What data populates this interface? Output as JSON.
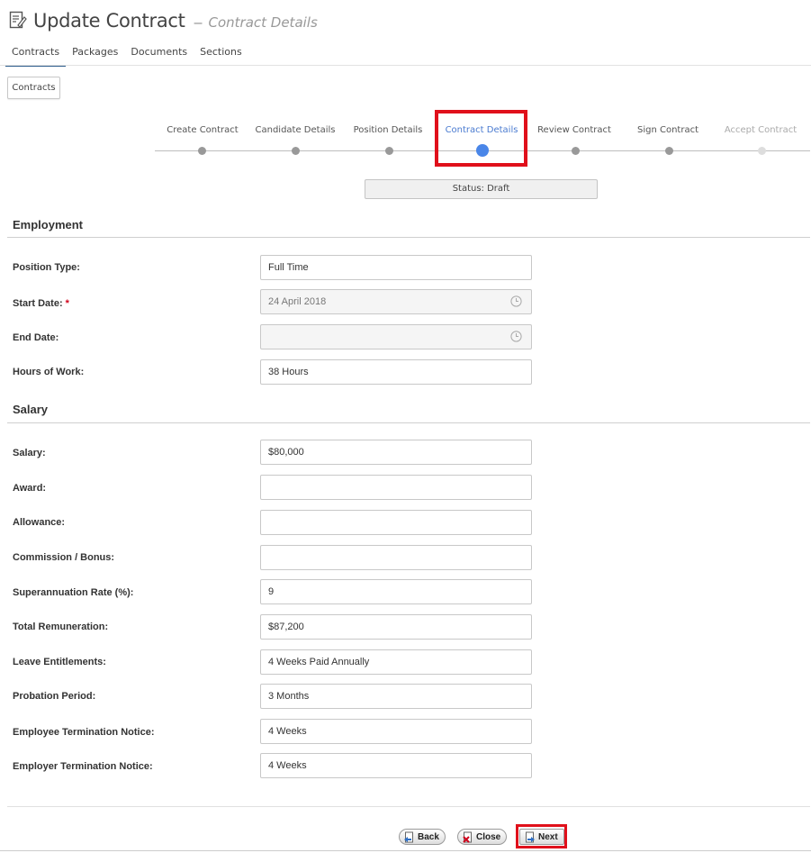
{
  "header": {
    "title": "Update Contract",
    "dash": "–",
    "subtitle": "Contract Details"
  },
  "tabs": [
    {
      "label": "Contracts",
      "active": true
    },
    {
      "label": "Packages",
      "active": false
    },
    {
      "label": "Documents",
      "active": false
    },
    {
      "label": "Sections",
      "active": false
    }
  ],
  "contracts_button": "Contracts",
  "wizard": {
    "steps": [
      {
        "label": "Create Contract",
        "state": "done"
      },
      {
        "label": "Candidate Details",
        "state": "done"
      },
      {
        "label": "Position Details",
        "state": "done"
      },
      {
        "label": "Contract Details",
        "state": "active"
      },
      {
        "label": "Review Contract",
        "state": "pending"
      },
      {
        "label": "Sign Contract",
        "state": "pending"
      },
      {
        "label": "Accept Contract",
        "state": "disabled"
      }
    ],
    "accent_color": "#4a86e8"
  },
  "status": "Status: Draft",
  "employment": {
    "title": "Employment",
    "position_type": {
      "label": "Position Type:",
      "value": "Full Time"
    },
    "start_date": {
      "label": "Start Date:",
      "required_mark": "*",
      "value": "24 April 2018"
    },
    "end_date": {
      "label": "End Date:",
      "value": ""
    },
    "hours_of_work": {
      "label": "Hours of Work:",
      "value": "38 Hours"
    }
  },
  "salary": {
    "title": "Salary",
    "salary": {
      "label": "Salary:",
      "value": "$80,000"
    },
    "award": {
      "label": "Award:",
      "value": ""
    },
    "allowance": {
      "label": "Allowance:",
      "value": ""
    },
    "commission": {
      "label": "Commission / Bonus:",
      "value": ""
    },
    "super_rate": {
      "label": "Superannuation Rate (%):",
      "value": "9"
    },
    "total_remuneration": {
      "label": "Total Remuneration:",
      "value": "$87,200"
    },
    "leave": {
      "label": "Leave Entitlements:",
      "value": "4 Weeks Paid Annually"
    },
    "probation": {
      "label": "Probation Period:",
      "value": "3 Months"
    },
    "employee_notice": {
      "label": "Employee Termination Notice:",
      "value": "4 Weeks"
    },
    "employer_notice": {
      "label": "Employer Termination Notice:",
      "value": "4 Weeks"
    }
  },
  "buttons": {
    "back": "Back",
    "close": "Close",
    "next": "Next"
  },
  "colors": {
    "highlight": "#e0101b",
    "required": "#d0021b"
  }
}
